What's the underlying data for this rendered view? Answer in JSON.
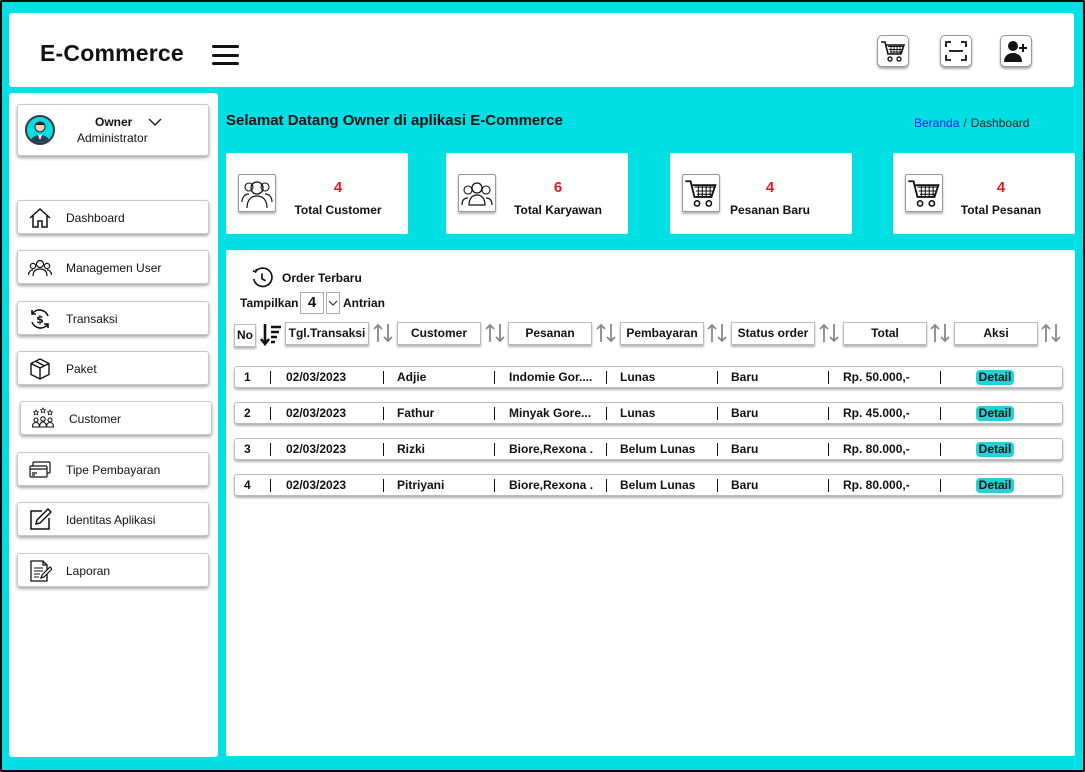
{
  "header": {
    "brand": "E-Commerce",
    "icons": [
      "cart-icon",
      "scan-icon",
      "add-user-icon"
    ]
  },
  "sidebar": {
    "profile": {
      "name": "Owner",
      "role": "Administrator"
    },
    "items": [
      {
        "label": "Dashboard",
        "icon": "home-icon"
      },
      {
        "label": "Managemen User",
        "icon": "users-icon"
      },
      {
        "label": "Transaksi",
        "icon": "money-exchange-icon"
      },
      {
        "label": "Paket",
        "icon": "package-icon"
      },
      {
        "label": "Customer",
        "icon": "customers-icon"
      },
      {
        "label": "Tipe Pembayaran",
        "icon": "payment-cards-icon"
      },
      {
        "label": "Identitas Aplikasi",
        "icon": "edit-icon"
      },
      {
        "label": "Laporan",
        "icon": "report-icon"
      }
    ]
  },
  "main": {
    "welcome": "Selamat Datang Owner di aplikasi E-Commerce",
    "breadcrumb": {
      "home": "Beranda",
      "sep": "/",
      "current": "Dashboard"
    },
    "cards": [
      {
        "value": "4",
        "label": "Total Customer",
        "icon": "customer-group-icon"
      },
      {
        "value": "6",
        "label": "Total Karyawan",
        "icon": "employee-group-icon"
      },
      {
        "value": "4",
        "label": "Pesanan Baru",
        "icon": "cart-icon"
      },
      {
        "value": "4",
        "label": "Total Pesanan",
        "icon": "cart-icon"
      }
    ],
    "colors": {
      "accent": "#00e0e4",
      "value": "#e01b24",
      "link": "#2323e8",
      "detail": "#1fd4d8"
    }
  },
  "orders": {
    "title": "Order Terbaru",
    "show_label": "Tampilkan",
    "show_value": "4",
    "queue_label": "Antrian",
    "columns": [
      "No",
      "Tgl.Transaksi",
      "Customer",
      "Pesanan",
      "Pembayaran",
      "Status order",
      "Total",
      "Aksi"
    ],
    "rows": [
      {
        "no": "1",
        "date": "02/03/2023",
        "customer": "Adjie",
        "order": "Indomie Gor....",
        "payment": "Lunas",
        "status": "Baru",
        "total": "Rp. 50.000,-",
        "action": "Detail"
      },
      {
        "no": "2",
        "date": "02/03/2023",
        "customer": "Fathur",
        "order": "Minyak Gore...",
        "payment": "Lunas",
        "status": "Baru",
        "total": "Rp. 45.000,-",
        "action": "Detail"
      },
      {
        "no": "3",
        "date": "02/03/2023",
        "customer": "Rizki",
        "order": "Biore,Rexona ..",
        "payment": "Belum Lunas",
        "status": "Baru",
        "total": "Rp. 80.000,-",
        "action": "Detail"
      },
      {
        "no": "4",
        "date": "02/03/2023",
        "customer": "Pitriyani",
        "order": "Biore,Rexona ..",
        "payment": "Belum Lunas",
        "status": "Baru",
        "total": "Rp. 80.000,-",
        "action": "Detail"
      }
    ]
  }
}
